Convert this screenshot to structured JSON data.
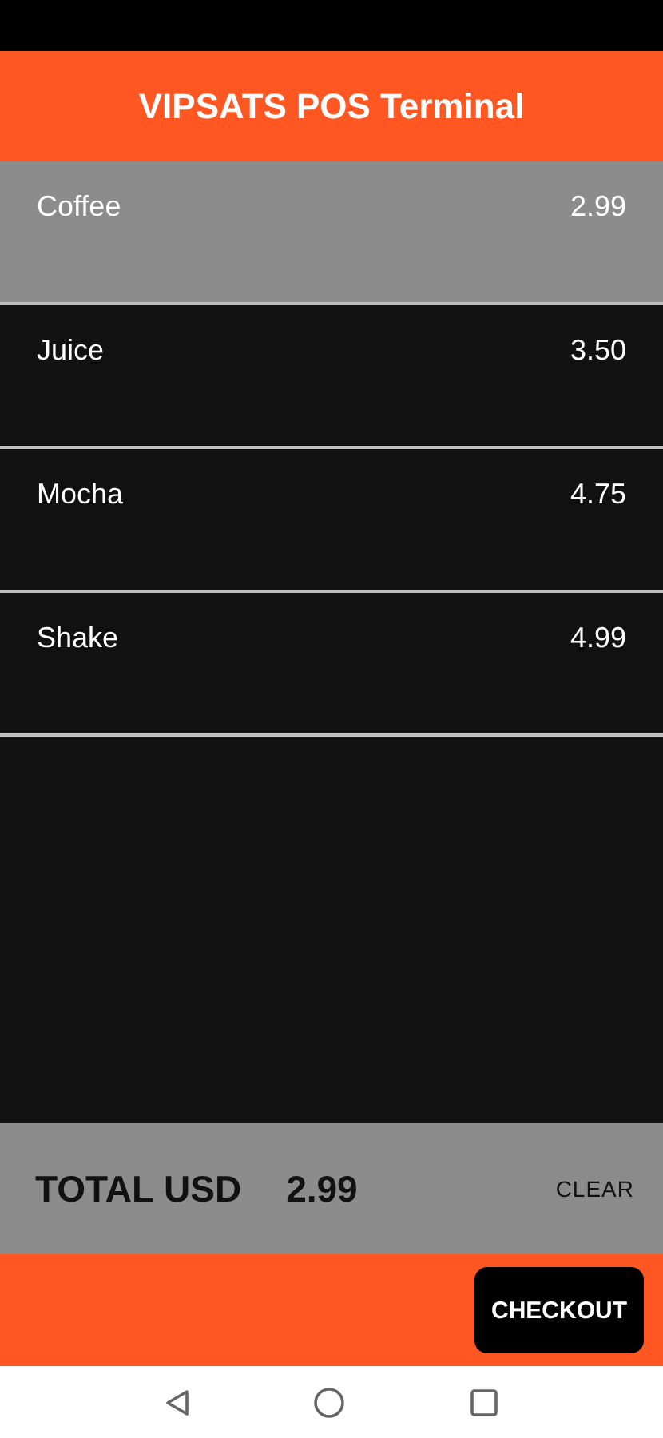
{
  "header": {
    "title": "VIPSATS POS Terminal"
  },
  "items": [
    {
      "name": "Coffee",
      "price": "2.99",
      "selected": true
    },
    {
      "name": "Juice",
      "price": "3.50",
      "selected": false
    },
    {
      "name": "Mocha",
      "price": "4.75",
      "selected": false
    },
    {
      "name": "Shake",
      "price": "4.99",
      "selected": false
    }
  ],
  "total": {
    "label": "TOTAL USD",
    "amount": "2.99",
    "clear": "CLEAR"
  },
  "checkout": {
    "label": "CHECKOUT"
  }
}
